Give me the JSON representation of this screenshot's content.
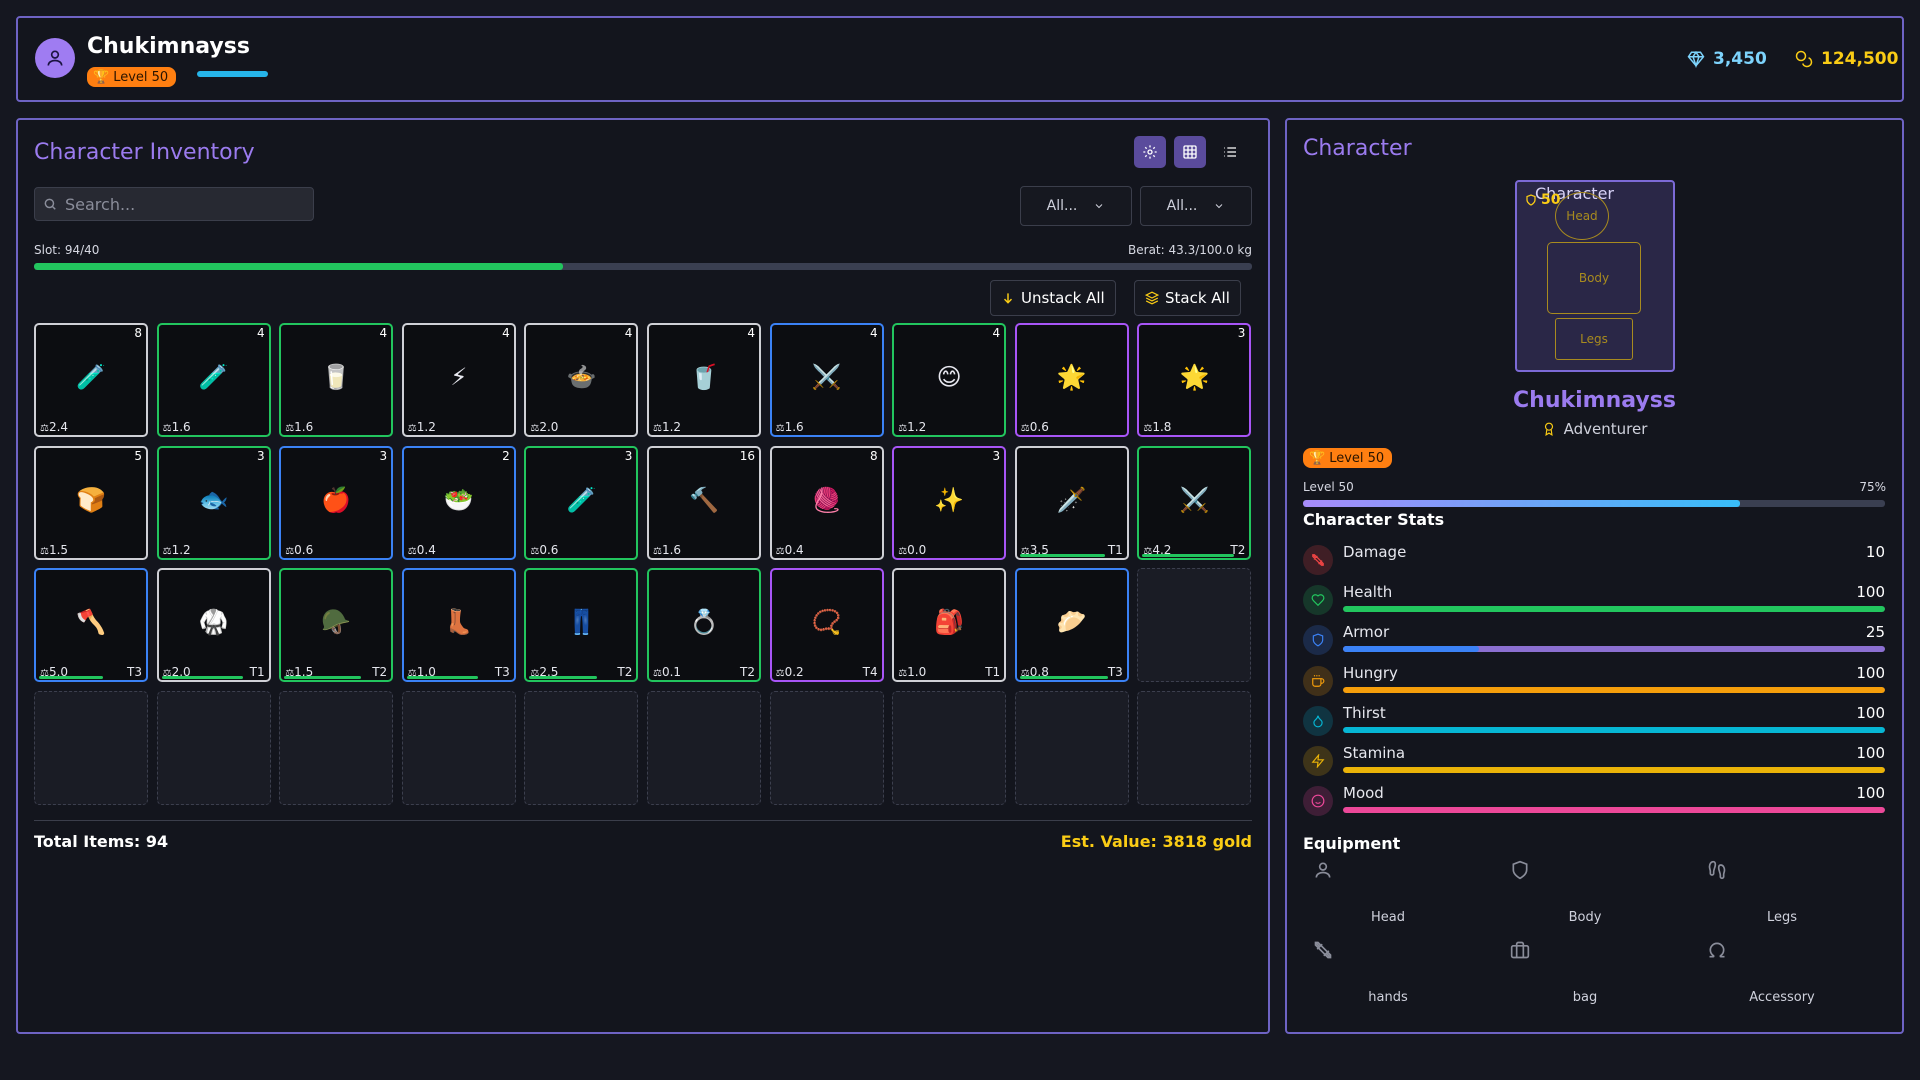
{
  "player": {
    "name": "Chukimnayss",
    "level_label": "Level 50",
    "level_progress": 0.75,
    "gems": "3,450",
    "gold": "124,500"
  },
  "inventory": {
    "title": "Character Inventory",
    "search_placeholder": "Search...",
    "filter1": "All...",
    "filter2": "All...",
    "slot_label": "Slot: 94/40",
    "slot_fill": 0.434,
    "weight_label": "Berat: 43.3/100.0 kg",
    "unstack_label": "Unstack All",
    "stack_label": "Stack All",
    "total_items": "Total Items: 94",
    "est_value": "Est. Value: 3818 gold",
    "items": [
      {
        "emoji": "🧪",
        "qty": "8",
        "wt": "2.4",
        "tier": "",
        "rarity": "common"
      },
      {
        "emoji": "🧪",
        "qty": "4",
        "wt": "1.6",
        "tier": "",
        "rarity": "uncommon"
      },
      {
        "emoji": "🥛",
        "qty": "4",
        "wt": "1.6",
        "tier": "",
        "rarity": "uncommon"
      },
      {
        "emoji": "⚡",
        "qty": "4",
        "wt": "1.2",
        "tier": "",
        "rarity": "common"
      },
      {
        "emoji": "🍲",
        "qty": "4",
        "wt": "2.0",
        "tier": "",
        "rarity": "common"
      },
      {
        "emoji": "🥤",
        "qty": "4",
        "wt": "1.2",
        "tier": "",
        "rarity": "common"
      },
      {
        "emoji": "⚔️",
        "qty": "4",
        "wt": "1.6",
        "tier": "",
        "rarity": "rare"
      },
      {
        "emoji": "😊",
        "qty": "4",
        "wt": "1.2",
        "tier": "",
        "rarity": "uncommon"
      },
      {
        "emoji": "🌟",
        "qty": "",
        "wt": "0.6",
        "tier": "",
        "rarity": "epic"
      },
      {
        "emoji": "🌟",
        "qty": "3",
        "wt": "1.8",
        "tier": "",
        "rarity": "epic"
      },
      {
        "emoji": "🍞",
        "qty": "5",
        "wt": "1.5",
        "tier": "",
        "rarity": "common"
      },
      {
        "emoji": "🐟",
        "qty": "3",
        "wt": "1.2",
        "tier": "",
        "rarity": "uncommon"
      },
      {
        "emoji": "🍎",
        "qty": "3",
        "wt": "0.6",
        "tier": "",
        "rarity": "rare"
      },
      {
        "emoji": "🥗",
        "qty": "2",
        "wt": "0.4",
        "tier": "",
        "rarity": "rare"
      },
      {
        "emoji": "🧪",
        "qty": "3",
        "wt": "0.6",
        "tier": "",
        "rarity": "uncommon"
      },
      {
        "emoji": "🔨",
        "qty": "16",
        "wt": "1.6",
        "tier": "",
        "rarity": "common"
      },
      {
        "emoji": "🧶",
        "qty": "8",
        "wt": "0.4",
        "tier": "",
        "rarity": "common"
      },
      {
        "emoji": "✨",
        "qty": "3",
        "wt": "0.0",
        "tier": "",
        "rarity": "epic"
      },
      {
        "emoji": "🗡️",
        "qty": "",
        "wt": "3.5",
        "tier": "T1",
        "rarity": "common",
        "durability": 0.82
      },
      {
        "emoji": "⚔️",
        "qty": "",
        "wt": "4.2",
        "tier": "T2",
        "rarity": "uncommon",
        "durability": 0.88
      },
      {
        "emoji": "🪓",
        "qty": "",
        "wt": "5.0",
        "tier": "T3",
        "rarity": "rare",
        "durability": 0.62
      },
      {
        "emoji": "🥋",
        "qty": "",
        "wt": "2.0",
        "tier": "T1",
        "rarity": "common",
        "durability": 0.78
      },
      {
        "emoji": "🪖",
        "qty": "",
        "wt": "1.5",
        "tier": "T2",
        "rarity": "uncommon",
        "durability": 0.74
      },
      {
        "emoji": "👢",
        "qty": "",
        "wt": "1.0",
        "tier": "T3",
        "rarity": "rare",
        "durability": 0.68
      },
      {
        "emoji": "👖",
        "qty": "",
        "wt": "2.5",
        "tier": "T2",
        "rarity": "uncommon",
        "durability": 0.65
      },
      {
        "emoji": "💍",
        "qty": "",
        "wt": "0.1",
        "tier": "T2",
        "rarity": "uncommon",
        "durability": 0.0
      },
      {
        "emoji": "📿",
        "qty": "",
        "wt": "0.2",
        "tier": "T4",
        "rarity": "epic",
        "durability": 0.0
      },
      {
        "emoji": "🎒",
        "qty": "",
        "wt": "1.0",
        "tier": "T1",
        "rarity": "common",
        "durability": 0.0
      },
      {
        "emoji": "🥟",
        "qty": "",
        "wt": "0.8",
        "tier": "T3",
        "rarity": "rare",
        "durability": 0.85
      }
    ]
  },
  "character": {
    "title": "Character",
    "portrait_badge": "50",
    "portrait_alt_text": "Character",
    "slot_head": "Head",
    "slot_body": "Body",
    "slot_legs": "Legs",
    "name": "Chukimnayss",
    "class": "Adventurer",
    "level_badge": "Level 50",
    "level_label": "Level 50",
    "level_percent": "75%",
    "level_progress": 0.75,
    "stats_title": "Character Stats",
    "stats": [
      {
        "name": "Damage",
        "value": "10",
        "color": "#ef4444",
        "icon": "swords-icon",
        "fill": null
      },
      {
        "name": "Health",
        "value": "100",
        "color": "#22c55e",
        "icon": "heart-icon",
        "fill": 1.0
      },
      {
        "name": "Armor",
        "value": "25",
        "color": "#3b82f6",
        "icon": "shield-icon",
        "fill": 0.25
      },
      {
        "name": "Hungry",
        "value": "100",
        "color": "#f59e0b",
        "icon": "food-icon",
        "fill": 1.0
      },
      {
        "name": "Thirst",
        "value": "100",
        "color": "#06b6d4",
        "icon": "droplet-icon",
        "fill": 1.0
      },
      {
        "name": "Stamina",
        "value": "100",
        "color": "#eab308",
        "icon": "bolt-icon",
        "fill": 1.0
      },
      {
        "name": "Mood",
        "value": "100",
        "color": "#ec4899",
        "icon": "smile-icon",
        "fill": 1.0
      }
    ],
    "equipment_title": "Equipment",
    "equipment": [
      {
        "label": "Head",
        "icon": "user-icon"
      },
      {
        "label": "Body",
        "icon": "shield-icon"
      },
      {
        "label": "Legs",
        "icon": "footprints-icon"
      },
      {
        "label": "hands",
        "icon": "swords-icon"
      },
      {
        "label": "bag",
        "icon": "briefcase-icon"
      },
      {
        "label": "Accessory",
        "icon": "omega-icon"
      }
    ]
  },
  "colors": {
    "panel_border": "#6e63c4",
    "accent_purple": "#9b7bef",
    "gold": "#facc15",
    "gem": "#7dd3fc",
    "level_orange": "#ff7f11",
    "rarity_common": "#cfd0d6",
    "rarity_uncommon": "#22c55e",
    "rarity_rare": "#3b82f6",
    "rarity_epic": "#a855f7"
  }
}
